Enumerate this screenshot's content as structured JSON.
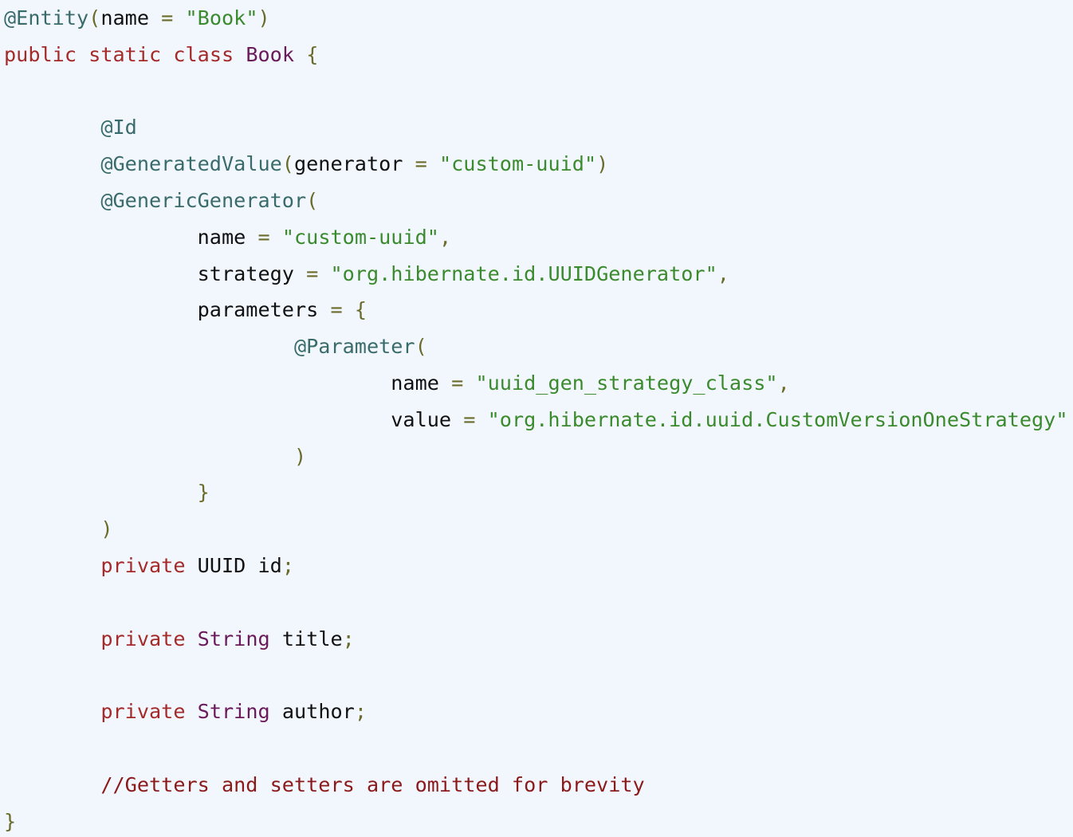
{
  "colors": {
    "background": "#f1f7fd",
    "annotation": "#3a6b6b",
    "keyword": "#a52a2a",
    "type": "#6a1a5a",
    "string": "#3b8a2e",
    "operator": "#6b6b2a",
    "identifier": "#111111",
    "comment": "#8b1a1a"
  },
  "code": {
    "lines": [
      [
        [
          "annotation",
          "@Entity"
        ],
        [
          "punct",
          "("
        ],
        [
          "ident",
          "name"
        ],
        [
          "space",
          " "
        ],
        [
          "operator",
          "="
        ],
        [
          "space",
          " "
        ],
        [
          "string",
          "\"Book\""
        ],
        [
          "punct",
          ")"
        ]
      ],
      [
        [
          "keyword",
          "public"
        ],
        [
          "space",
          " "
        ],
        [
          "keyword",
          "static"
        ],
        [
          "space",
          " "
        ],
        [
          "keyword",
          "class"
        ],
        [
          "space",
          " "
        ],
        [
          "type",
          "Book"
        ],
        [
          "space",
          " "
        ],
        [
          "punct",
          "{"
        ]
      ],
      [],
      [
        [
          "space",
          "        "
        ],
        [
          "annotation",
          "@Id"
        ]
      ],
      [
        [
          "space",
          "        "
        ],
        [
          "annotation",
          "@GeneratedValue"
        ],
        [
          "punct",
          "("
        ],
        [
          "ident",
          "generator"
        ],
        [
          "space",
          " "
        ],
        [
          "operator",
          "="
        ],
        [
          "space",
          " "
        ],
        [
          "string",
          "\"custom-uuid\""
        ],
        [
          "punct",
          ")"
        ]
      ],
      [
        [
          "space",
          "        "
        ],
        [
          "annotation",
          "@GenericGenerator"
        ],
        [
          "punct",
          "("
        ]
      ],
      [
        [
          "space",
          "                "
        ],
        [
          "ident",
          "name"
        ],
        [
          "space",
          " "
        ],
        [
          "operator",
          "="
        ],
        [
          "space",
          " "
        ],
        [
          "string",
          "\"custom-uuid\""
        ],
        [
          "punct",
          ","
        ]
      ],
      [
        [
          "space",
          "                "
        ],
        [
          "ident",
          "strategy"
        ],
        [
          "space",
          " "
        ],
        [
          "operator",
          "="
        ],
        [
          "space",
          " "
        ],
        [
          "string",
          "\"org.hibernate.id.UUIDGenerator\""
        ],
        [
          "punct",
          ","
        ]
      ],
      [
        [
          "space",
          "                "
        ],
        [
          "ident",
          "parameters"
        ],
        [
          "space",
          " "
        ],
        [
          "operator",
          "="
        ],
        [
          "space",
          " "
        ],
        [
          "punct",
          "{"
        ]
      ],
      [
        [
          "space",
          "                        "
        ],
        [
          "annotation",
          "@Parameter"
        ],
        [
          "punct",
          "("
        ]
      ],
      [
        [
          "space",
          "                                "
        ],
        [
          "ident",
          "name"
        ],
        [
          "space",
          " "
        ],
        [
          "operator",
          "="
        ],
        [
          "space",
          " "
        ],
        [
          "string",
          "\"uuid_gen_strategy_class\""
        ],
        [
          "punct",
          ","
        ]
      ],
      [
        [
          "space",
          "                                "
        ],
        [
          "ident",
          "value"
        ],
        [
          "space",
          " "
        ],
        [
          "operator",
          "="
        ],
        [
          "space",
          " "
        ],
        [
          "string",
          "\"org.hibernate.id.uuid.CustomVersionOneStrategy\""
        ]
      ],
      [
        [
          "space",
          "                        "
        ],
        [
          "punct",
          ")"
        ]
      ],
      [
        [
          "space",
          "                "
        ],
        [
          "punct",
          "}"
        ]
      ],
      [
        [
          "space",
          "        "
        ],
        [
          "punct",
          ")"
        ]
      ],
      [
        [
          "space",
          "        "
        ],
        [
          "keyword",
          "private"
        ],
        [
          "space",
          " "
        ],
        [
          "ident",
          "UUID"
        ],
        [
          "space",
          " "
        ],
        [
          "ident",
          "id"
        ],
        [
          "punct",
          ";"
        ]
      ],
      [],
      [
        [
          "space",
          "        "
        ],
        [
          "keyword",
          "private"
        ],
        [
          "space",
          " "
        ],
        [
          "type",
          "String"
        ],
        [
          "space",
          " "
        ],
        [
          "ident",
          "title"
        ],
        [
          "punct",
          ";"
        ]
      ],
      [],
      [
        [
          "space",
          "        "
        ],
        [
          "keyword",
          "private"
        ],
        [
          "space",
          " "
        ],
        [
          "type",
          "String"
        ],
        [
          "space",
          " "
        ],
        [
          "ident",
          "author"
        ],
        [
          "punct",
          ";"
        ]
      ],
      [],
      [
        [
          "space",
          "        "
        ],
        [
          "comment",
          "//Getters and setters are omitted for brevity"
        ]
      ],
      [
        [
          "punct",
          "}"
        ]
      ]
    ]
  }
}
